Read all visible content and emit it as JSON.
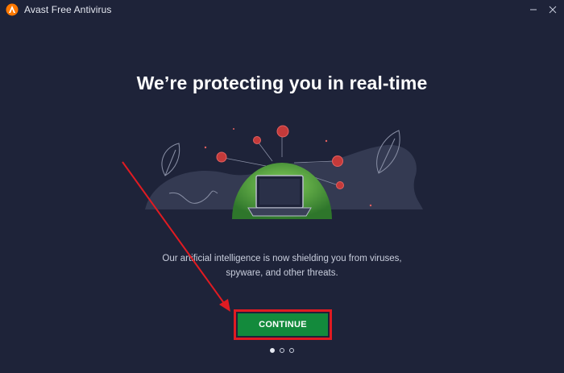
{
  "window": {
    "title": "Avast Free Antivirus",
    "icons": {
      "logo": "avast-logo-icon",
      "minimize": "minimize-icon",
      "close": "close-icon"
    }
  },
  "onboarding": {
    "headline": "We’re protecting you in real-time",
    "description_line1": "Our artificial intelligence is now shielding you from viruses,",
    "description_line2": "spyware, and other threats.",
    "continue_label": "CONTINUE",
    "page_indicator": {
      "total_pages": 3,
      "current_page": 1
    }
  },
  "colors": {
    "background": "#1e2339",
    "continue_button": "#138a3c",
    "highlight_annotation": "#e01b22",
    "brand_orange": "#ff7800",
    "shield_green": "#5fbf3a",
    "virus_red": "#c43a3a"
  }
}
